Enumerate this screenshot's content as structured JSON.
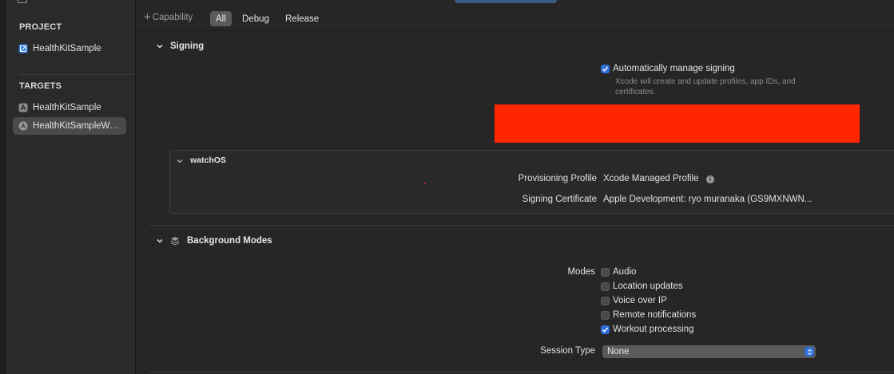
{
  "sidebar": {
    "project_header": "PROJECT",
    "project_item": "HealthKitSample",
    "targets_header": "TARGETS",
    "targets": [
      {
        "label": "HealthKitSample",
        "selected": false
      },
      {
        "label": "HealthKitSampleWa...",
        "selected": true
      }
    ]
  },
  "toolbar": {
    "capability_label": "Capability",
    "segments": [
      "All",
      "Debug",
      "Release"
    ],
    "active_segment": "All"
  },
  "signing": {
    "title": "Signing",
    "auto_manage_label": "Automatically manage signing",
    "auto_manage_checked": true,
    "auto_manage_desc_line1": "Xcode will create and update profiles, app IDs, and",
    "auto_manage_desc_line2": "certificates.",
    "watchos": {
      "title": "watchOS",
      "provisioning_label": "Provisioning Profile",
      "provisioning_value": "Xcode Managed Profile",
      "certificate_label": "Signing Certificate",
      "certificate_value": "Apple Development: ryo muranaka (GS9MXNWN..."
    }
  },
  "background_modes": {
    "title": "Background Modes",
    "modes_label": "Modes",
    "modes": [
      {
        "label": "Audio",
        "checked": false
      },
      {
        "label": "Location updates",
        "checked": false
      },
      {
        "label": "Voice over IP",
        "checked": false
      },
      {
        "label": "Remote notifications",
        "checked": false
      },
      {
        "label": "Workout processing",
        "checked": true
      }
    ],
    "session_type_label": "Session Type",
    "session_type_value": "None"
  },
  "colors": {
    "accent": "#2f6fd9",
    "redaction": "#ff2600",
    "background": "#262626"
  }
}
